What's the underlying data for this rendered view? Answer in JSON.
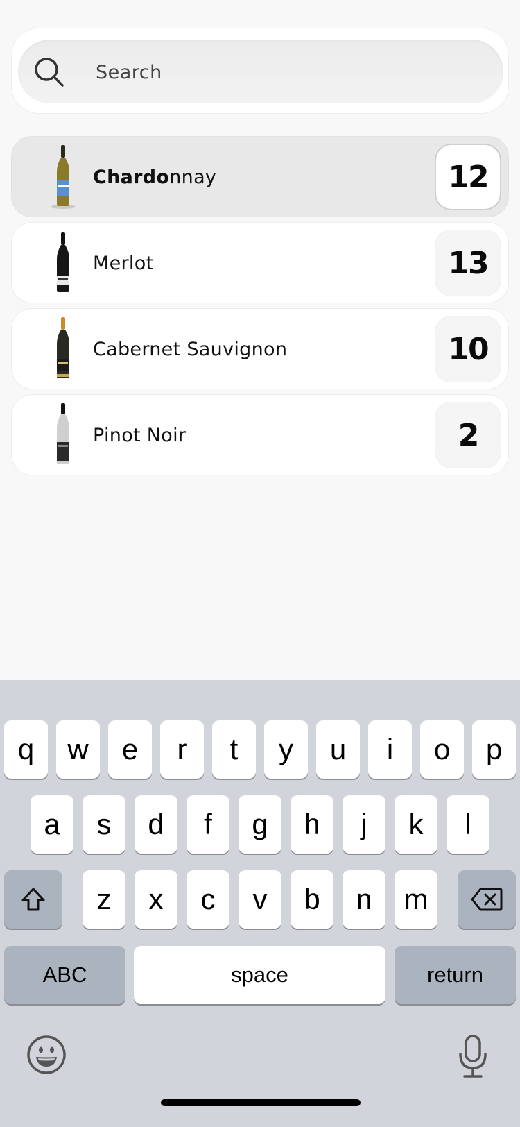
{
  "search": {
    "placeholder": "Search",
    "value": ""
  },
  "wines": [
    {
      "label_bold": "Chardo",
      "label_rest": "nnay",
      "count": "12",
      "selected": true
    },
    {
      "label_bold": "",
      "label_rest": "Merlot",
      "count": "13",
      "selected": false
    },
    {
      "label_bold": "",
      "label_rest": "Cabernet Sauvignon",
      "count": "10",
      "selected": false
    },
    {
      "label_bold": "",
      "label_rest": "Pinot Noir",
      "count": "2",
      "selected": false
    }
  ],
  "keyboard": {
    "row1": [
      "q",
      "w",
      "e",
      "r",
      "t",
      "y",
      "u",
      "i",
      "o",
      "p"
    ],
    "row2": [
      "a",
      "s",
      "d",
      "f",
      "g",
      "h",
      "j",
      "k",
      "l"
    ],
    "row3": [
      "z",
      "x",
      "c",
      "v",
      "b",
      "n",
      "m"
    ],
    "abc_label": "ABC",
    "space_label": "space",
    "return_label": "return"
  },
  "icons": {
    "search": "search-icon",
    "shift": "shift-icon",
    "backspace": "backspace-icon",
    "emoji": "emoji-icon",
    "mic": "microphone-icon"
  },
  "colors": {
    "background": "#f8f8f8",
    "selected_row": "#e8e8e8",
    "keyboard_bg": "#d1d5db",
    "key_gray": "#abb3bf"
  }
}
